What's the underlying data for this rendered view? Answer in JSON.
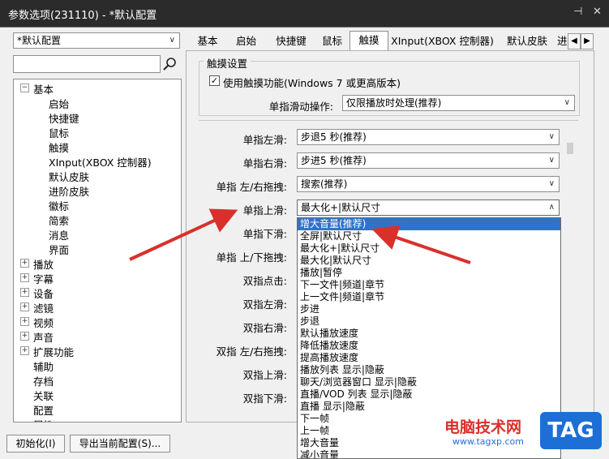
{
  "window": {
    "title": "参数选项(231110) - *默认配置",
    "pin_glyph": "⊣",
    "close_glyph": "✕"
  },
  "profile": {
    "value": "*默认配置"
  },
  "search": {
    "placeholder": ""
  },
  "tree": {
    "root": "基本",
    "children": [
      "启始",
      "快捷键",
      "鼠标",
      "触摸",
      "XInput(XBOX 控制器)",
      "默认皮肤",
      "进阶皮肤",
      "徽标",
      "简索",
      "消息",
      "界面"
    ],
    "top_level": [
      {
        "label": "播放",
        "expandable": true
      },
      {
        "label": "字幕",
        "expandable": true
      },
      {
        "label": "设备",
        "expandable": true
      },
      {
        "label": "滤镜",
        "expandable": true
      },
      {
        "label": "视频",
        "expandable": true
      },
      {
        "label": "声音",
        "expandable": true
      },
      {
        "label": "扩展功能",
        "expandable": true
      },
      {
        "label": "辅助",
        "expandable": false
      },
      {
        "label": "存档",
        "expandable": false
      },
      {
        "label": "关联",
        "expandable": false
      },
      {
        "label": "配置",
        "expandable": false
      },
      {
        "label": "属性",
        "expandable": false
      }
    ]
  },
  "tabs": [
    "基本",
    "启始",
    "快捷键",
    "鼠标",
    "触摸",
    "XInput(XBOX 控制器)",
    "默认皮肤",
    "进"
  ],
  "active_tab": "触摸",
  "touch": {
    "group_title": "触摸设置",
    "enable_label": "使用触摸功能(Windows 7 或更高版本)",
    "enable_checked": true,
    "single_slide_label": "单指滑动操作:",
    "single_slide_value": "仅限播放时处理(推荐)",
    "rows": [
      {
        "label": "单指左滑:",
        "value": "步退5 秒(推荐)"
      },
      {
        "label": "单指右滑:",
        "value": "步进5 秒(推荐)"
      },
      {
        "label": "单指 左/右拖拽:",
        "value": "搜索(推荐)"
      },
      {
        "label": "单指上滑:",
        "value": "最大化+|默认尺寸"
      },
      {
        "label": "单指下滑:",
        "value": ""
      },
      {
        "label": "单指 上/下拖拽:",
        "value": ""
      },
      {
        "label": "双指点击:",
        "value": ""
      },
      {
        "label": "双指左滑:",
        "value": ""
      },
      {
        "label": "双指右滑:",
        "value": ""
      },
      {
        "label": "双指 左/右拖拽:",
        "value": ""
      },
      {
        "label": "双指上滑:",
        "value": ""
      },
      {
        "label": "双指下滑:",
        "value": ""
      }
    ]
  },
  "dropdown": {
    "options": [
      "增大音量(推荐)",
      "全屏|默认尺寸",
      "最大化+|默认尺寸",
      "最大化|默认尺寸",
      "播放|暂停",
      "下一文件|频道|章节",
      "上一文件|频道|章节",
      "步进",
      "步退",
      "默认播放速度",
      "降低播放速度",
      "提高播放速度",
      "播放列表 显示|隐蔽",
      "聊天/浏览器窗口 显示|隐蔽",
      "直播/VOD 列表 显示|隐蔽",
      "直播 显示|隐蔽",
      "下一帧",
      "上一帧",
      "增大音量",
      "减小音量"
    ],
    "selected_index": 0
  },
  "buttons": {
    "init": "初始化(I)",
    "export": "导出当前配置(S)..."
  },
  "watermark": {
    "site": "电脑技术网",
    "url": "www.tagxp.com",
    "badge": "TAG"
  },
  "colors": {
    "titlebar": "#2b2b2b",
    "selection": "#2f73c9",
    "arrow": "#d9302b",
    "badge": "#1d6fd6"
  }
}
